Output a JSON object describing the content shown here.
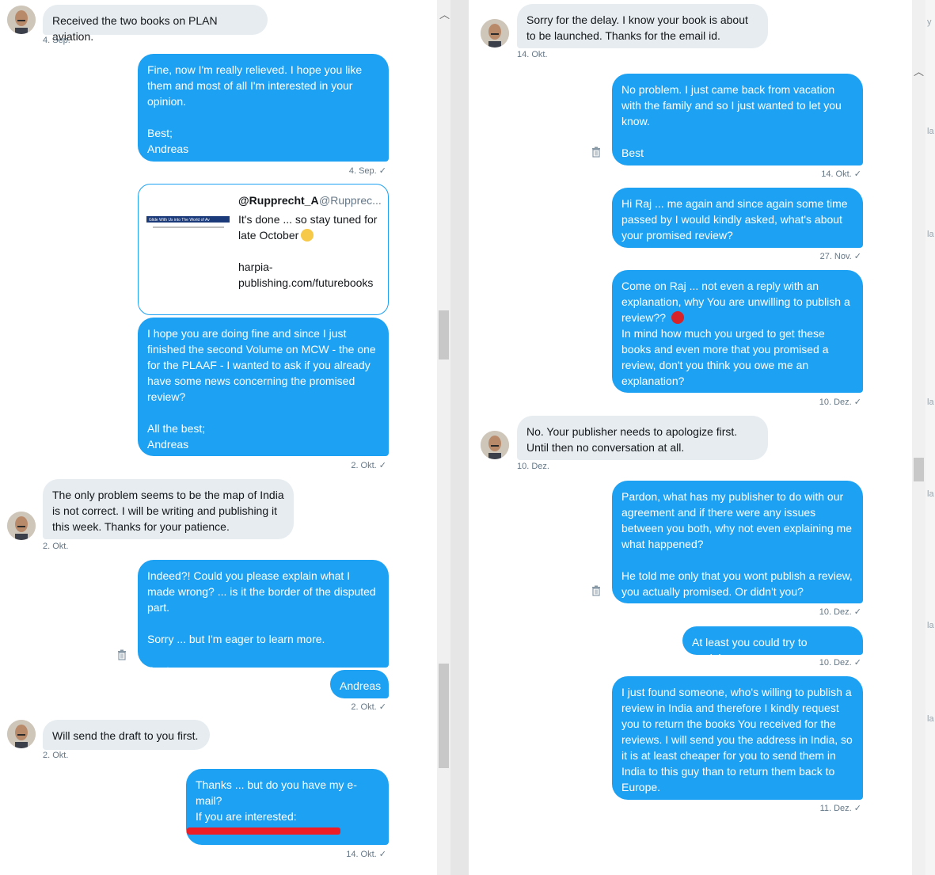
{
  "left_messages": {
    "m1": {
      "text": "Received the two books on PLAN aviation.",
      "time": "4. Sep."
    },
    "m2": {
      "text": "Fine, now I'm really relieved. I hope you like them and most of all I'm interested in your opinion.\n\nBest;\nAndreas",
      "time": "4. Sep. ✓"
    },
    "card": {
      "author": "@Rupprecht_A",
      "handle": "@Rupprec...",
      "text": "It's done ... so stay tuned for late October",
      "link": "harpia-publishing.com/futurebooks",
      "thumb_text": "Glide With Us into The World of Av"
    },
    "m3": {
      "text": "I hope you are doing fine and since I just finished the second Volume on MCW - the one for the PLAAF - I wanted to ask if you already have some news concerning the promised review?\n\nAll the best;\nAndreas",
      "time": "2. Okt. ✓"
    },
    "m4": {
      "text": "The only problem seems to be the map of India is not correct. I will be writing and publishing it this week. Thanks for your patience.",
      "time": "2. Okt."
    },
    "m5": {
      "text": "Indeed?! Could you please explain what I made wrong? ... is it the border of the disputed part.\n\nSorry ... but I'm eager to learn more.\n\nBest,"
    },
    "m6": {
      "text": "Andreas",
      "time": "2. Okt. ✓"
    },
    "m7": {
      "text": "Will send the draft to you first.",
      "time": "2. Okt."
    },
    "m8": {
      "text": "Thanks ... but do you have my e-mail?\nIf you are interested:",
      "time": "14. Okt. ✓"
    }
  },
  "right_messages": {
    "r1": {
      "text": "Sorry for the delay. I know your book is about to be launched. Thanks for the email id.",
      "time": "14. Okt."
    },
    "r2": {
      "text": "No problem. I just came back from vacation with the family and so I just wanted to let you know.\n\nBest",
      "time": "14. Okt. ✓"
    },
    "r3": {
      "text": "Hi Raj ... me again and since again some time passed by I would kindly asked, what's about your promised review?",
      "time": "27. Nov. ✓"
    },
    "r4": {
      "text_a": "Come on Raj ... not even a reply with an explanation, why You are unwilling to publish a review?? ",
      "text_b": "In mind how much you urged to get these books and even more that you promised a review, don't you think you owe me an explanation?",
      "time": "10. Dez. ✓"
    },
    "r5": {
      "text": "No. Your publisher needs to apologize first.\nUntil then no conversation at all.",
      "time": "10. Dez."
    },
    "r6": {
      "text": "Pardon, what has my publisher to do with our agreement and if there were any issues between you both, why not even explaining me what happened?\n\nHe told me only that you wont publish a review, you actually promised. Or didn't you?",
      "time": "10. Dez. ✓"
    },
    "r7": {
      "text": "At least you could try to explain...",
      "time": "10. Dez. ✓"
    },
    "r8": {
      "text": "I just found someone, who's willing to publish a review in India and therefore I kindly request you to return the books You received for the reviews.  I will send you the address in India, so it is at least cheaper for you to send them in India to this guy than to return them back to Europe.",
      "time": "11. Dez. ✓"
    }
  },
  "colors": {
    "outgoing": "#1da1f2",
    "incoming": "#e6ecf0",
    "redaction": "#ee1c24"
  },
  "icons": [
    "avatar",
    "trash-icon",
    "wink-emoji",
    "angry-emoji",
    "scroll-up-arrow-icon"
  ],
  "edge_peek": [
    "y",
    "la",
    "la",
    "la",
    "la",
    "la",
    "la"
  ]
}
